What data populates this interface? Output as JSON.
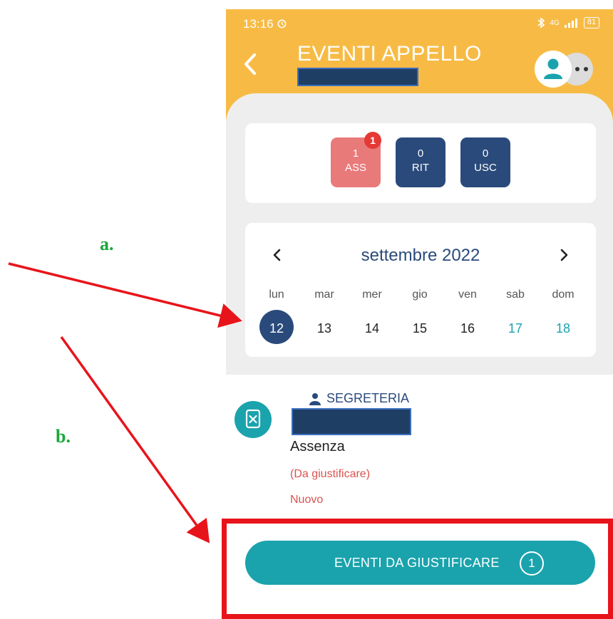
{
  "annotations": {
    "a": "a.",
    "b": "b."
  },
  "status_bar": {
    "time": "13:16",
    "signal": "4G",
    "battery": "81"
  },
  "header": {
    "title": "EVENTI APPELLO"
  },
  "counts": [
    {
      "value": "1",
      "label": "ASS",
      "badge": "1",
      "color": "#e97a7a"
    },
    {
      "value": "0",
      "label": "RIT",
      "color": "#2a4a7b"
    },
    {
      "value": "0",
      "label": "USC",
      "color": "#2a4a7b"
    }
  ],
  "calendar": {
    "month": "settembre 2022",
    "weekdays": [
      "lun",
      "mar",
      "mer",
      "gio",
      "ven",
      "sab",
      "dom"
    ],
    "days": [
      "12",
      "13",
      "14",
      "15",
      "16",
      "17",
      "18"
    ],
    "selected_day": "12"
  },
  "event": {
    "author": "SEGRETERIA",
    "type": "Assenza",
    "status": "(Da giustificare)",
    "tag": "Nuovo"
  },
  "action_button": {
    "label": "EVENTI DA GIUSTIFICARE",
    "count": "1"
  },
  "colors": {
    "header": "#f7bb45",
    "accent": "#1aa3ad",
    "navy": "#2a4a7b",
    "alert": "#d9534f",
    "highlight": "#e8141b"
  }
}
